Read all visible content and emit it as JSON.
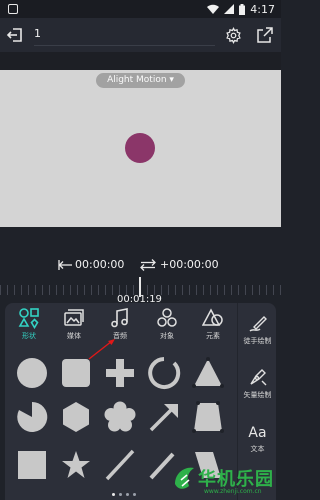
{
  "status_bar": {
    "time": "4:17"
  },
  "toolbar": {
    "project_name": "1"
  },
  "preview": {
    "watermark": "Alight Motion ▾",
    "dot_color": "#8b3669"
  },
  "timing": {
    "in_time": "00:00:00",
    "offset_time": "+00:00:00",
    "current_time": "00:01:19"
  },
  "tabs": [
    {
      "label": "形状",
      "icon": "shapes-icon",
      "active": true
    },
    {
      "label": "媒体",
      "icon": "media-icon",
      "active": false
    },
    {
      "label": "音频",
      "icon": "music-note-icon",
      "active": false
    },
    {
      "label": "对象",
      "icon": "objects-icon",
      "active": false
    },
    {
      "label": "元素",
      "icon": "elements-icon",
      "active": false
    }
  ],
  "side": {
    "freehand_label": "徒手绘制",
    "vector_label": "矢量绘制",
    "text_label": "文本",
    "text_glyph": "Aa"
  },
  "shapes": [
    "circle",
    "rounded-square",
    "plus",
    "arc",
    "triangle",
    "pie",
    "hexagon",
    "flower",
    "arrow",
    "trapezoid",
    "square",
    "star",
    "line",
    "pencil",
    "parallelogram"
  ],
  "brand": {
    "name": "华机乐园",
    "url": "www.zhenji.com.cn"
  },
  "colors": {
    "accent": "#33d3c4",
    "panel": "#2c2f39",
    "background": "#1f2229",
    "shape_fill": "#c8c8c8"
  }
}
